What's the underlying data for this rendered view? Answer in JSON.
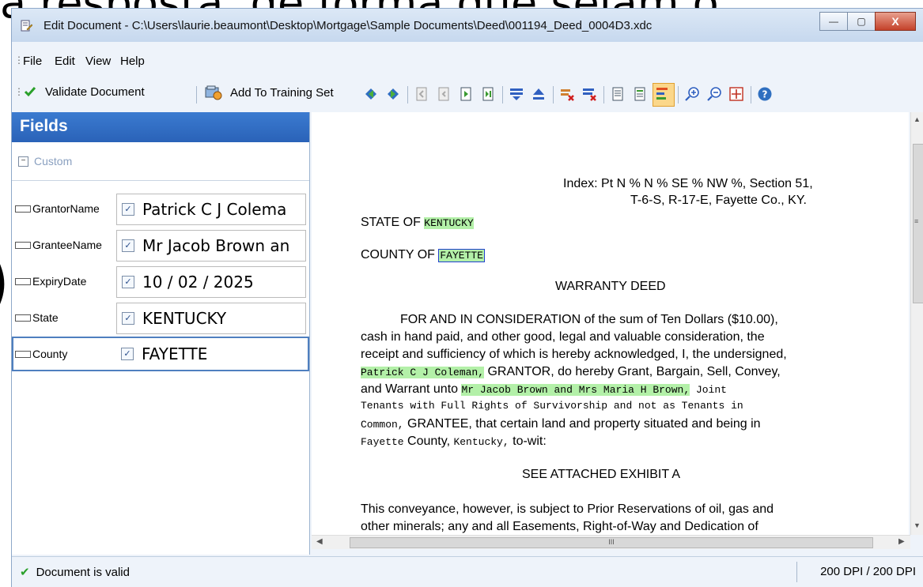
{
  "overlay": {
    "text": "a resposta, de forma que sejam o",
    "paren": ")"
  },
  "window": {
    "title": "Edit Document - C:\\Users\\laurie.beaumont\\Desktop\\Mortgage\\Sample Documents\\Deed\\001194_Deed_0004D3.xdc",
    "minimize_label": "—",
    "maximize_label": "▢",
    "close_label": "X"
  },
  "menu": {
    "grip": "⋮",
    "items": [
      "File",
      "Edit",
      "View",
      "Help"
    ]
  },
  "toolbar": {
    "grip": "⋮",
    "validate_label": "Validate Document",
    "add_training_label": "Add To Training Set"
  },
  "fields_panel": {
    "header": "Fields",
    "group": {
      "toggle": "−",
      "label": "Custom"
    },
    "check_mark": "✓",
    "rows": [
      {
        "name": "GrantorName",
        "value": "Patrick C J Colema",
        "checked": true
      },
      {
        "name": "GranteeName",
        "value": "Mr Jacob Brown an",
        "checked": true
      },
      {
        "name": "ExpiryDate",
        "value": "10 / 02 / 2025",
        "checked": true
      },
      {
        "name": "State",
        "value": "KENTUCKY",
        "checked": true
      },
      {
        "name": "County",
        "value": "FAYETTE",
        "checked": true
      }
    ]
  },
  "document": {
    "index_line1": "Index: Pt N % N % SE % NW %, Section 51,",
    "index_line2": "T-6-S, R-17-E, Fayette Co., KY.",
    "state_prefix": "STATE OF ",
    "state_value": "KENTUCKY",
    "county_prefix": "COUNTY OF ",
    "county_value": "FAYETTE",
    "heading": "WARRANTY DEED",
    "p1": "FOR AND IN CONSIDERATION of the sum of Ten Dollars ($10.00),",
    "p2": "cash in hand paid, and other good, legal and valuable consideration, the",
    "p3": "receipt and sufficiency of which is hereby acknowledged, I, the undersigned,",
    "p4_hl": "Patrick C J Coleman,",
    "p4_rest": " GRANTOR, do hereby Grant, Bargain, Sell, Convey,",
    "p5_pre": "and Warrant unto ",
    "p5_hl": "Mr Jacob Brown and Mrs Maria H Brown,",
    "p5_rest": " Joint",
    "p6": "Tenants with Full Rights of Survivorship and not as Tenants in",
    "p7_pre": "Common,",
    "p7_rest": " GRANTEE, that certain land and property situated and being in",
    "p8_a": "Fayette",
    "p8_b": " County, ",
    "p8_c": "Kentucky,",
    "p8_d": " to-wit:",
    "exhibit": "SEE ATTACHED EXHIBIT A",
    "p9": "This conveyance, however, is subject to Prior Reservations of oil, gas and",
    "p10": "other minerals; any and all Easements, Right-of-Way and Dedication of"
  },
  "scrollbars": {
    "up": "▲",
    "down": "▼",
    "left": "◀",
    "right": "▶",
    "h_grip": "III",
    "v_grip": "≡"
  },
  "status": {
    "icon": "✔",
    "message": "Document is valid",
    "dpi": "200 DPI / 200 DPI"
  },
  "colors": {
    "highlight": "#b3f0a8",
    "header_blue": "#2a62b8",
    "valid_green": "#2aa02a"
  }
}
